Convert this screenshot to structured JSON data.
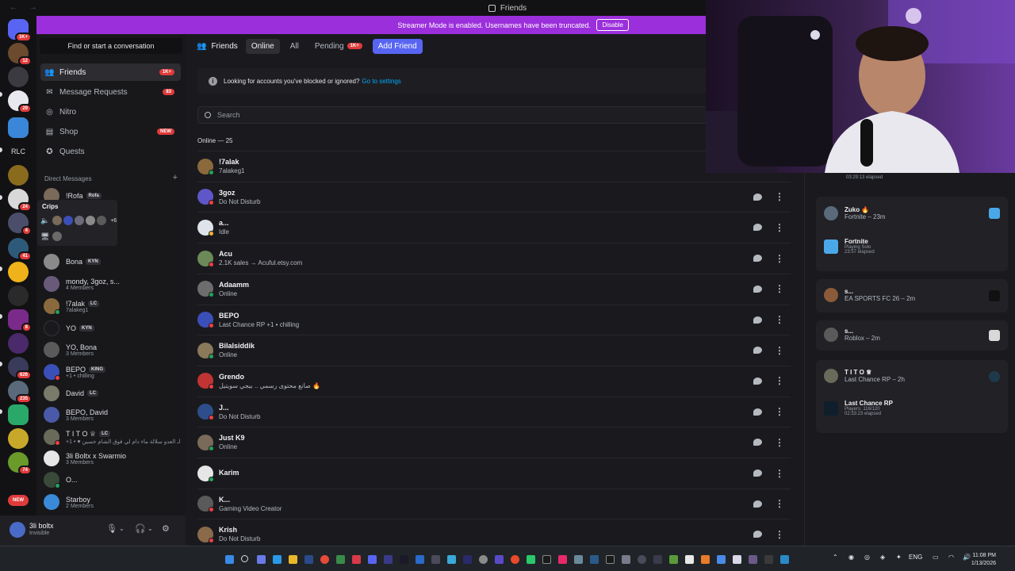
{
  "window": {
    "title": "Friends"
  },
  "banner": {
    "text": "Streamer Mode is enabled. Usernames have been truncated.",
    "button": "Disable"
  },
  "rail": {
    "badges": [
      "1K+",
      "12",
      "",
      "29",
      "",
      "RLC",
      "",
      "24",
      "4",
      "41",
      "",
      "8",
      "",
      "626",
      "235",
      "",
      "",
      "74",
      "NEW"
    ]
  },
  "sidebar": {
    "search": "Find or start a conversation",
    "nav": [
      {
        "label": "Friends",
        "badge": "1K+",
        "icon": "friends-icon"
      },
      {
        "label": "Message Requests",
        "badge": "83",
        "icon": "envelope-icon"
      },
      {
        "label": "Nitro",
        "badge": "",
        "icon": "nitro-icon"
      },
      {
        "label": "Shop",
        "badge": "NEW",
        "icon": "shop-icon"
      },
      {
        "label": "Quests",
        "badge": "",
        "icon": "quests-icon"
      }
    ],
    "dm_header": "Direct Messages",
    "dm_add": "+",
    "voice": {
      "title": "Crips",
      "extra": "+6"
    },
    "dms": [
      {
        "name": "!Rofa",
        "tag": "Rofa",
        "sub": ""
      },
      {
        "name": "Bona",
        "tag": "KYN",
        "sub": ""
      },
      {
        "name": "mondy, 3goz, s...",
        "tag": "",
        "sub": "4 Members"
      },
      {
        "name": "!7alak",
        "tag": "LC",
        "sub": "7alakeg1"
      },
      {
        "name": "YO",
        "tag": "KYN",
        "sub": ""
      },
      {
        "name": "YO, Bona",
        "tag": "",
        "sub": "3 Members"
      },
      {
        "name": "BEPO",
        "tag": "KING",
        "sub": "+1 • chilling"
      },
      {
        "name": "David",
        "tag": "LC",
        "sub": ""
      },
      {
        "name": "BEPO, David",
        "tag": "",
        "sub": "3 Members"
      },
      {
        "name": "T I T O ♕",
        "tag": "LC",
        "sub": "+1 • ♥ الـ العدو سلالة ماء دام لي فوق الشام حسين"
      },
      {
        "name": "3li Boltx x Swarmio",
        "tag": "",
        "sub": "3 Members"
      },
      {
        "name": "O...",
        "tag": "",
        "sub": ""
      },
      {
        "name": "Starboy",
        "tag": "",
        "sub": "2 Members"
      }
    ]
  },
  "user": {
    "name": "3li boltx",
    "status": "Invisible"
  },
  "main": {
    "title": "Friends",
    "tabs": [
      {
        "label": "Online",
        "badge": ""
      },
      {
        "label": "All",
        "badge": ""
      },
      {
        "label": "Pending",
        "badge": "1K+"
      }
    ],
    "add_friend": "Add Friend",
    "info_text": "Looking for accounts you've blocked or ignored?",
    "info_link": "Go to settings",
    "search_placeholder": "Search",
    "online_header": "Online — 25",
    "friends": [
      {
        "name": "!7alak",
        "sub": "7alakeg1",
        "status": "online",
        "color": "#8a6a3c"
      },
      {
        "name": "3goz",
        "sub": "Do Not Disturb",
        "status": "dnd",
        "color": "#5f56c9"
      },
      {
        "name": "a...",
        "sub": "Idle",
        "status": "idle",
        "color": "#dfe3ea"
      },
      {
        "name": "Acu",
        "sub": "2.1K sales → Acuful.etsy.com",
        "status": "dnd",
        "color": "#6b8a58"
      },
      {
        "name": "Adaamm",
        "sub": "Online",
        "status": "online",
        "color": "#6d6d6d"
      },
      {
        "name": "BEPO",
        "sub": "Last Chance RP +1 • chilling",
        "status": "dnd",
        "color": "#3b4fb8"
      },
      {
        "name": "Bilalsiddik",
        "sub": "Online",
        "status": "online",
        "color": "#8a7a5a"
      },
      {
        "name": "Grendo",
        "sub": "صانع محتوى رسمي .. بيجي سويتيل 🔥",
        "status": "dnd",
        "color": "#c03434"
      },
      {
        "name": "J...",
        "sub": "Do Not Disturb",
        "status": "dnd",
        "color": "#2d4e8a"
      },
      {
        "name": "Just K9",
        "sub": "Online",
        "status": "online",
        "color": "#7a6a5a"
      },
      {
        "name": "Karim",
        "sub": "",
        "status": "online",
        "color": "#e6e6e6"
      },
      {
        "name": "K...",
        "sub": "Gaming Video Creator",
        "status": "dnd",
        "color": "#5a5a5a"
      },
      {
        "name": "Krish",
        "sub": "Do Not Disturb",
        "status": "dnd",
        "color": "#8a6a4a"
      }
    ]
  },
  "activity": {
    "top_elapsed": "03:29:13 elapsed",
    "cards": [
      {
        "user": "Zuko 🔥",
        "line": "Fortnite – 23m",
        "game": "Fortnite",
        "detail": "Playing Solo",
        "elapsed": "23:57 elapsed"
      },
      {
        "user": "s...",
        "line": "EA SPORTS FC 26 – 2m"
      },
      {
        "user": "s...",
        "line": "Roblox – 2m"
      },
      {
        "user": "T I T O ♕",
        "line": "Last Chance RP – 2h",
        "game": "Last Chance RP",
        "detail": "Players: 116/120",
        "elapsed": "02:33:23 elapsed"
      }
    ]
  },
  "taskbar": {
    "lang": "ENG",
    "time": "11:08 PM",
    "date": "1/13/2026"
  }
}
